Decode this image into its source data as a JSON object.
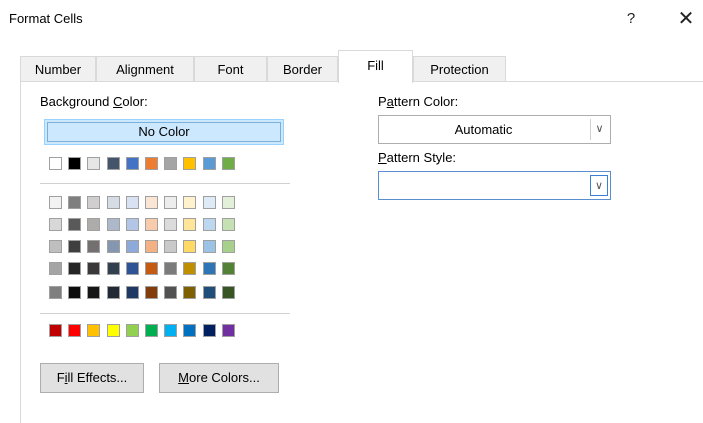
{
  "window": {
    "title": "Format Cells",
    "help": "?",
    "close": "✕"
  },
  "tabs": [
    "Number",
    "Alignment",
    "Font",
    "Border",
    "Fill",
    "Protection"
  ],
  "active_tab": "Fill",
  "background": {
    "label_pre": "Background ",
    "label_u": "C",
    "label_post": "olor:",
    "no_color": "No Color"
  },
  "theme_row": [
    "#ffffff",
    "#000000",
    "#e7e6e6",
    "#44546a",
    "#4472c4",
    "#ed7d31",
    "#a5a5a5",
    "#ffc000",
    "#5b9bd5",
    "#70ad47"
  ],
  "tint_rows": [
    [
      "#f2f2f2",
      "#7f7f7f",
      "#d0cece",
      "#d6dce4",
      "#d9e2f3",
      "#fbe5d5",
      "#ededed",
      "#fff2cc",
      "#deebf6",
      "#e2efd9"
    ],
    [
      "#d8d8d8",
      "#595959",
      "#aeabab",
      "#adb9ca",
      "#b4c6e7",
      "#f7cbac",
      "#dbdbdb",
      "#fee599",
      "#bdd7ee",
      "#c5e0b3"
    ],
    [
      "#bfbfbf",
      "#3f3f3f",
      "#757070",
      "#8496b0",
      "#8eaadb",
      "#f4b183",
      "#c9c9c9",
      "#ffd965",
      "#9cc3e5",
      "#a8d08d"
    ],
    [
      "#a5a5a5",
      "#262626",
      "#3a3838",
      "#323f4f",
      "#2f5496",
      "#c55a11",
      "#7b7b7b",
      "#bf8f00",
      "#2e75b5",
      "#538135"
    ],
    [
      "#7f7f7f",
      "#0c0c0c",
      "#171616",
      "#222a35",
      "#1f3864",
      "#833c0b",
      "#525252",
      "#7f6000",
      "#1e4e79",
      "#375623"
    ]
  ],
  "standard_row": [
    "#c00000",
    "#ff0000",
    "#ffc000",
    "#ffff00",
    "#92d050",
    "#00b050",
    "#00b0f0",
    "#0070c0",
    "#002060",
    "#7030a0"
  ],
  "buttons": {
    "fill_effects_pre": "F",
    "fill_effects_u": "i",
    "fill_effects_post": "ll Effects...",
    "more_colors_u": "M",
    "more_colors_post": "ore Colors..."
  },
  "pattern": {
    "color_label_pre": "P",
    "color_label_u": "a",
    "color_label_post": "ttern Color:",
    "color_value": "Automatic",
    "style_label_u": "P",
    "style_label_post": "attern Style:",
    "style_value": ""
  }
}
